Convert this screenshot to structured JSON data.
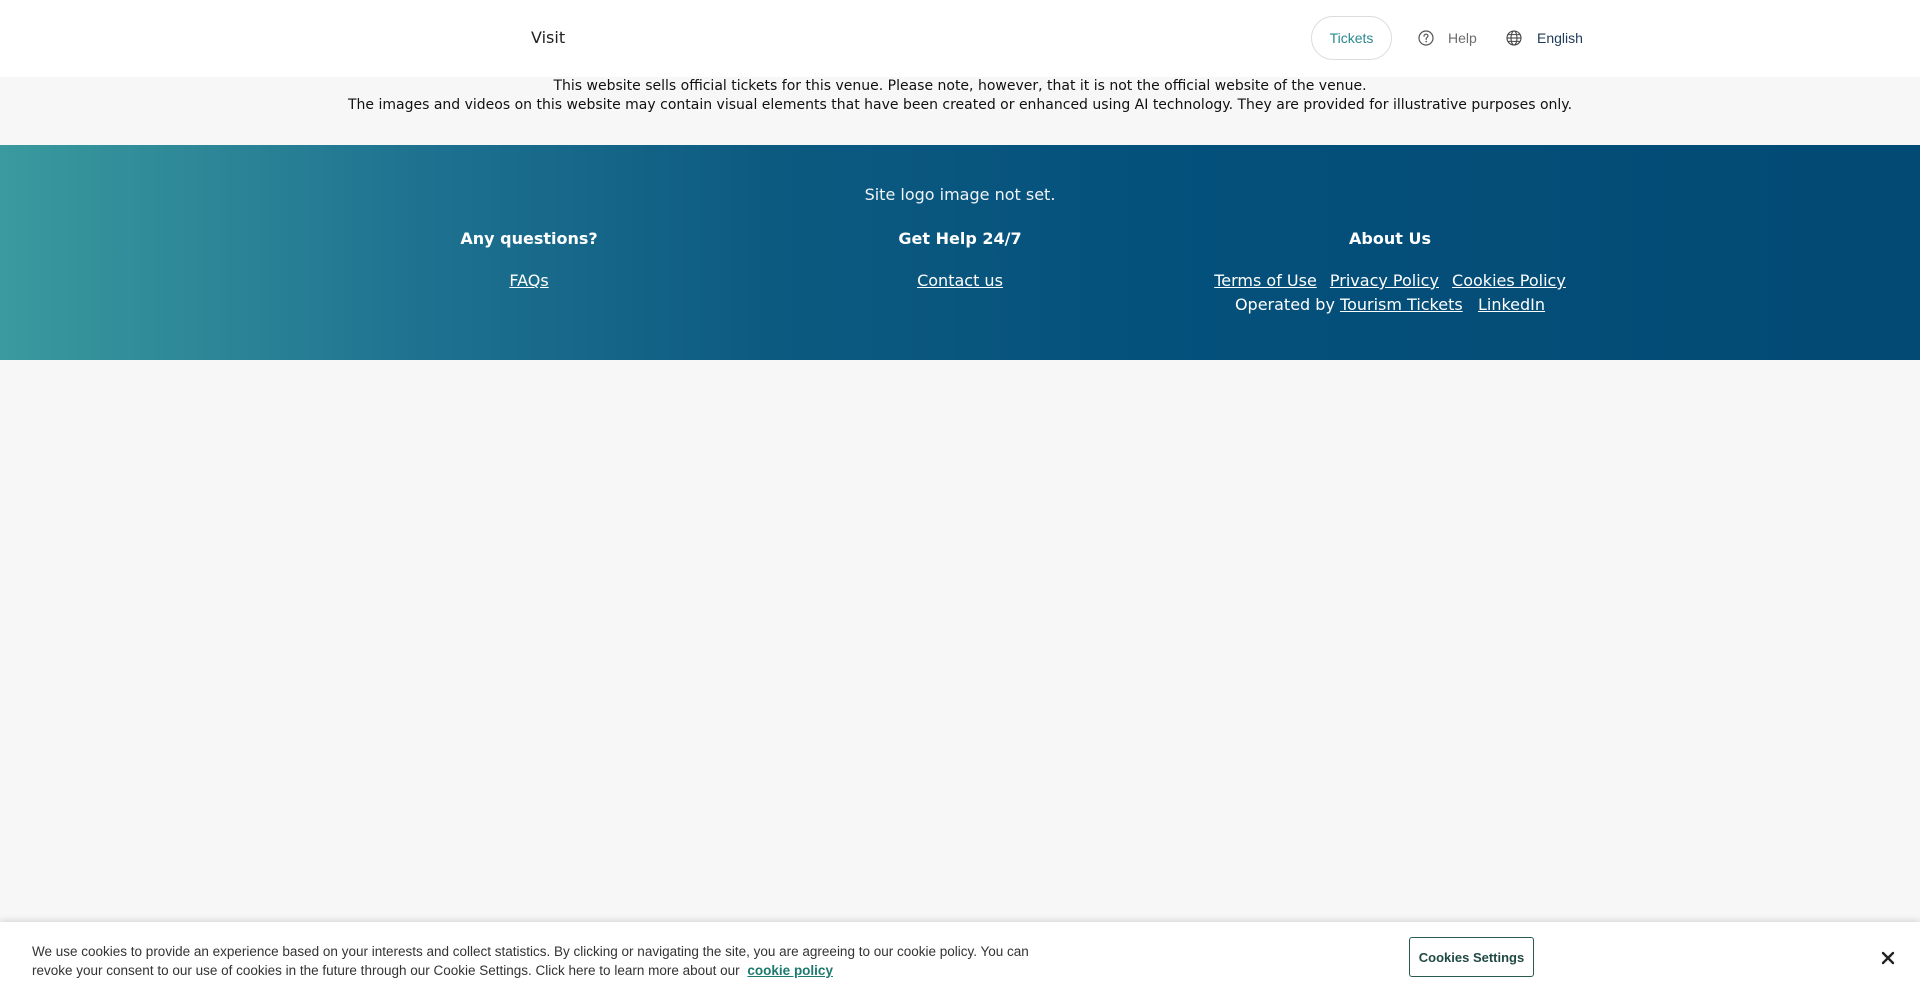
{
  "header": {
    "nav_visit": "Visit",
    "tickets_label": "Tickets",
    "help_label": "Help",
    "language_label": "English",
    "icons": {
      "help": "question-circle-icon",
      "language": "globe-icon"
    }
  },
  "disclaimer": {
    "line1": "This website sells official tickets for this venue. Please note, however, that it is not the official website of the venue.",
    "line2": "The images and videos on this website may contain visual elements that have been created or enhanced using AI technology. They are provided for illustrative purposes only."
  },
  "footer": {
    "site_logo_text": "Site logo image not set.",
    "questions": {
      "heading": "Any questions?",
      "faqs": "FAQs"
    },
    "help": {
      "heading": "Get Help 24/7",
      "contact": "Contact us"
    },
    "about": {
      "heading": "About Us",
      "terms": "Terms of Use",
      "privacy": "Privacy Policy",
      "cookies": "Cookies Policy",
      "operated_by": "Operated by",
      "tourism_tickets": "Tourism Tickets",
      "linkedin": "LinkedIn"
    }
  },
  "cookie_banner": {
    "text": "We use cookies to provide an experience based on your interests and collect statistics. By clicking or navigating the site, you are agreeing to our cookie policy. You can revoke your consent to our use of cookies in the future through our Cookie Settings. Click here to learn more about our",
    "policy_link": "cookie policy",
    "settings_button": "Cookies Settings",
    "close_icon": "close-icon"
  },
  "colors": {
    "accent": "#2a8a8f",
    "footer_start": "#3a9a9e",
    "footer_end": "#034a74",
    "cookie_link": "#1e7a6e"
  }
}
